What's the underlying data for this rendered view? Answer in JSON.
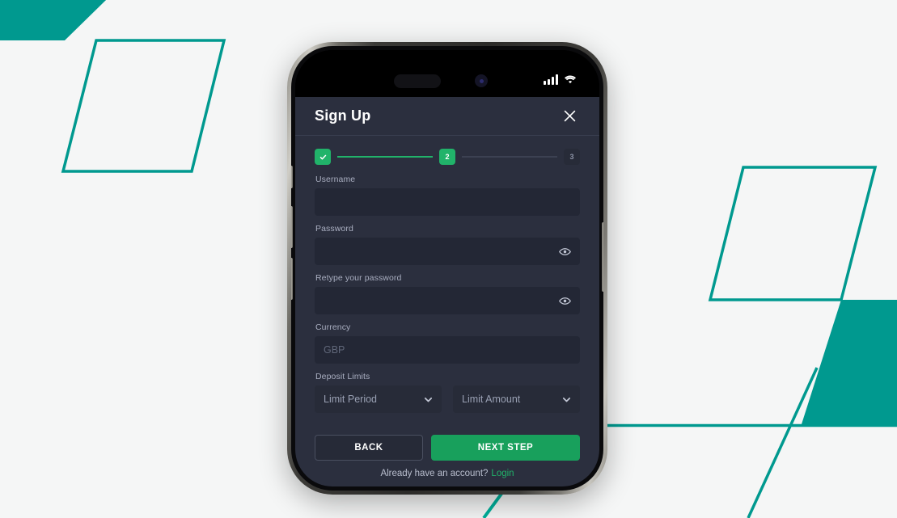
{
  "theme": {
    "accent_teal": "#00998f",
    "accent_green": "#21b36a",
    "button_green": "#18a05c",
    "modal_bg": "#2b2f3e",
    "input_bg": "#232735",
    "page_bg": "#f5f6f6"
  },
  "status_bar": {
    "signal_icon": "cellular-bars-icon",
    "wifi_icon": "wifi-icon"
  },
  "modal": {
    "title": "Sign Up",
    "close_icon": "close-icon",
    "stepper": {
      "steps": [
        {
          "label": "",
          "state": "done",
          "icon": "check-icon"
        },
        {
          "label": "2",
          "state": "active",
          "icon": ""
        },
        {
          "label": "3",
          "state": "todo",
          "icon": ""
        }
      ]
    },
    "fields": [
      {
        "label": "Username",
        "value": "",
        "placeholder": "",
        "type": "text"
      },
      {
        "label": "Password",
        "value": "",
        "placeholder": "",
        "type": "password"
      },
      {
        "label": "Retype your password",
        "value": "",
        "placeholder": "",
        "type": "password"
      },
      {
        "label": "Currency",
        "value": "",
        "placeholder": "GBP",
        "type": "text"
      }
    ],
    "deposit_limits": {
      "label": "Deposit Limits",
      "period": {
        "value": "Limit Period",
        "chevron_icon": "chevron-down-icon"
      },
      "amount": {
        "value": "Limit Amount",
        "chevron_icon": "chevron-down-icon"
      }
    },
    "buttons": {
      "back": "BACK",
      "next": "NEXT STEP"
    },
    "footer": {
      "text": "Already have an account?",
      "link": "Login"
    },
    "eye_icon": "eye-icon"
  }
}
